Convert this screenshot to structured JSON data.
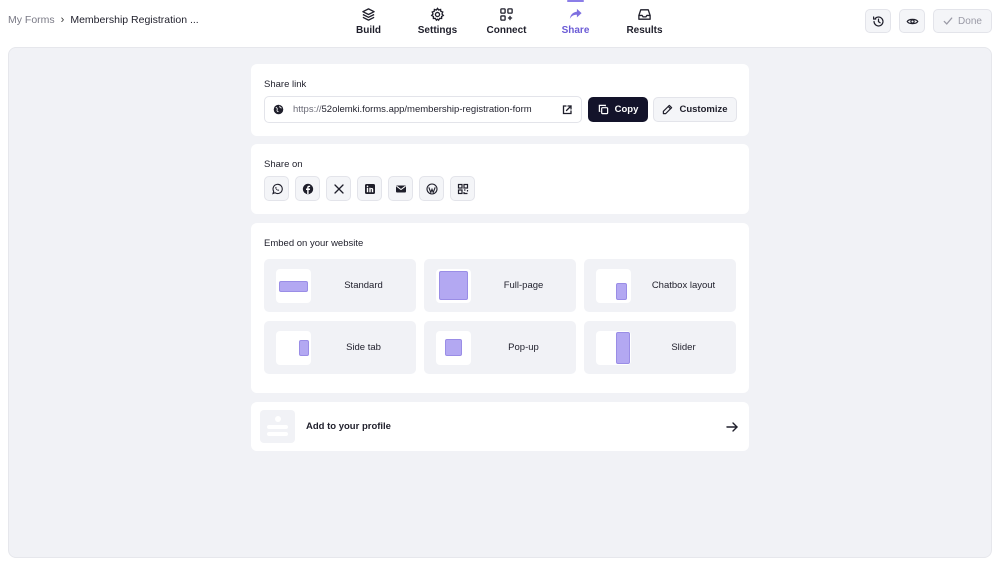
{
  "breadcrumb": {
    "root": "My Forms",
    "separator": "›",
    "current": "Membership Registration ..."
  },
  "tabs": [
    {
      "label": "Build",
      "icon": "build-layers-icon",
      "active": false
    },
    {
      "label": "Settings",
      "icon": "gear-icon",
      "active": false
    },
    {
      "label": "Connect",
      "icon": "connect-grid-plus-icon",
      "active": false
    },
    {
      "label": "Share",
      "icon": "share-arrow-icon",
      "active": true
    },
    {
      "label": "Results",
      "icon": "inbox-icon",
      "active": false
    }
  ],
  "top_actions": {
    "history_icon": "history-icon",
    "preview_icon": "eye-icon",
    "done_label": "Done"
  },
  "share_link": {
    "title": "Share link",
    "url_protocol": "https://",
    "url_rest": "52olemki.forms.app/membership-registration-form",
    "copy_label": "Copy",
    "customize_label": "Customize"
  },
  "share_on": {
    "title": "Share on",
    "platforms": [
      "whatsapp-icon",
      "facebook-icon",
      "x-icon",
      "linkedin-icon",
      "email-icon",
      "wordpress-icon",
      "qr-code-icon"
    ]
  },
  "embed": {
    "title": "Embed on your website",
    "options": [
      {
        "label": "Standard"
      },
      {
        "label": "Full-page"
      },
      {
        "label": "Chatbox layout"
      },
      {
        "label": "Side tab"
      },
      {
        "label": "Pop-up"
      },
      {
        "label": "Slider"
      }
    ]
  },
  "profile": {
    "label": "Add to your profile"
  },
  "colors": {
    "accent": "#6b5bd6",
    "canvas_bg": "#f1f2f6",
    "primary_button": "#13132a",
    "embed_shape": "#b3a8f2"
  }
}
